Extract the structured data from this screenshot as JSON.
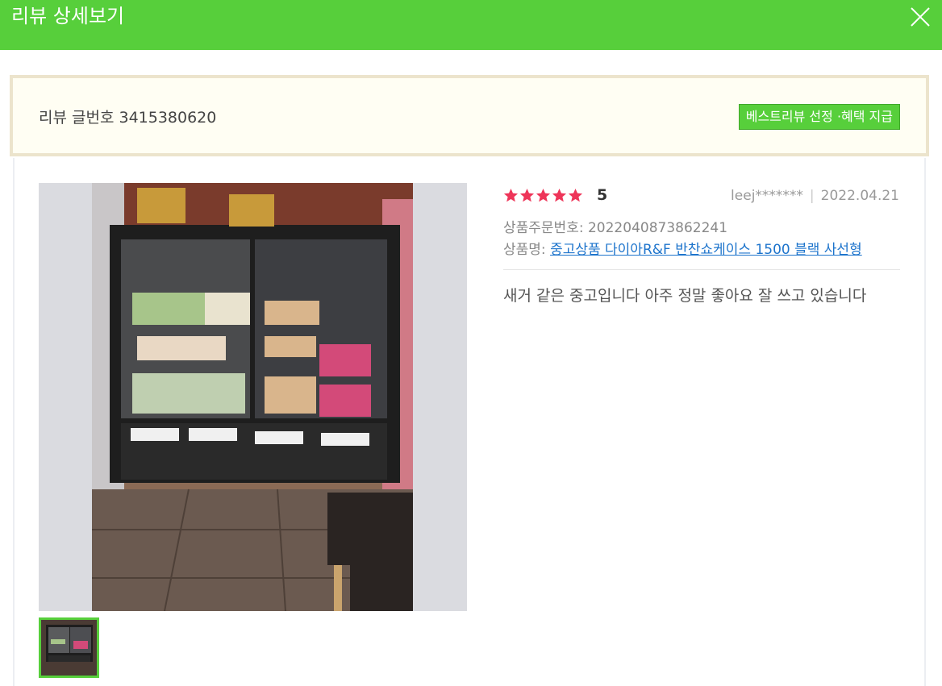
{
  "header": {
    "title": "리뷰 상세보기"
  },
  "info": {
    "review_number": "리뷰 글번호 3415380620",
    "best_button": "베스트리뷰 선정 ·혜택 지급"
  },
  "review": {
    "rating": 5,
    "rating_text": "5",
    "author": "leej*******",
    "date": "2022.04.21",
    "order_label": "상품주문번호:",
    "order_number": "2022040873862241",
    "product_label": "상품명:",
    "product_name": "중고상품 다이아R&F 반찬쇼케이스 1500 블랙 사선형",
    "text": "새거 같은 중고입니다 아주 정말 좋아요 잘 쓰고 있습니다"
  },
  "colors": {
    "accent": "#57cf3b",
    "star": "#ee3559",
    "link": "#1d74cc"
  }
}
